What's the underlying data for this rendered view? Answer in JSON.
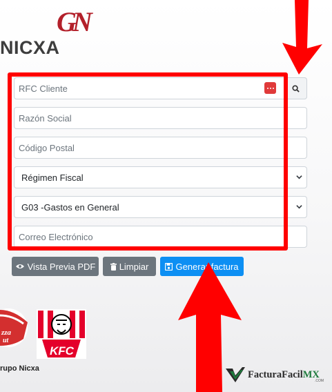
{
  "header": {
    "logo_letters": "GN",
    "brand_name": "NICXA"
  },
  "form": {
    "rfc_placeholder": "RFC Cliente",
    "razon_placeholder": "Razón Social",
    "cp_placeholder": "Código Postal",
    "regimen_selected": "Régimen Fiscal",
    "uso_selected": "G03 -Gastos en General",
    "correo_placeholder": "Correo Electrónico"
  },
  "actions": {
    "preview_label": "Vista Previa PDF",
    "clear_label": "Limpiar",
    "generate_label": "Generar factura"
  },
  "footer": {
    "pizza_logo": "Pizza Hut",
    "kfc_logo": "KFC",
    "group_label": "rupo Nicxa",
    "ff_main": "FacturaFacil",
    "ff_mx": "MX",
    "ff_com": ".COM"
  },
  "colors": {
    "highlight": "#ff0000",
    "primary": "#0d8ff3",
    "secondary": "#6c757d",
    "brand_red": "#b3202a"
  }
}
